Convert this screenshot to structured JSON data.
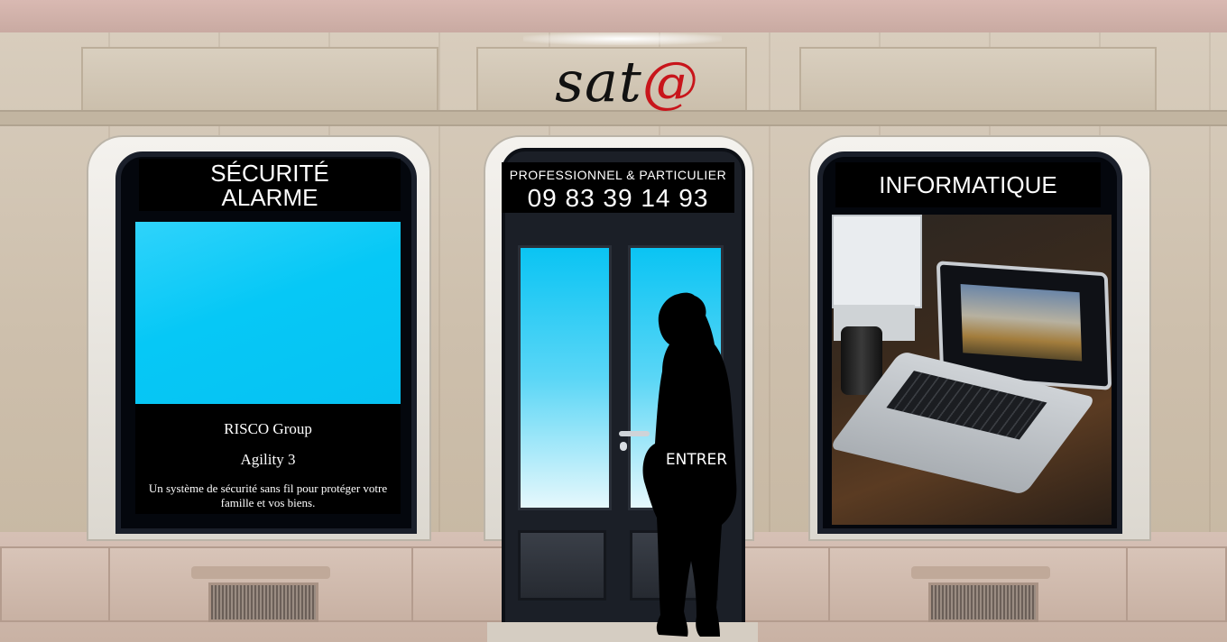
{
  "brand": {
    "logo_text": "sat",
    "logo_at": "@",
    "accent": "#c8151b"
  },
  "left_window": {
    "sign_line1": "SÉCURITÉ",
    "sign_line2": "ALARME",
    "product_brand": "RISCO Group",
    "product_name": "Agility 3",
    "product_desc": "Un système de sécurité sans fil pour protéger votre famille et vos biens."
  },
  "door": {
    "sign_top": "PROFESSIONNEL & PARTICULIER",
    "phone": "09 83 39 14 93",
    "enter_label": "ENTRER"
  },
  "right_window": {
    "sign": "INFORMATIQUE"
  }
}
